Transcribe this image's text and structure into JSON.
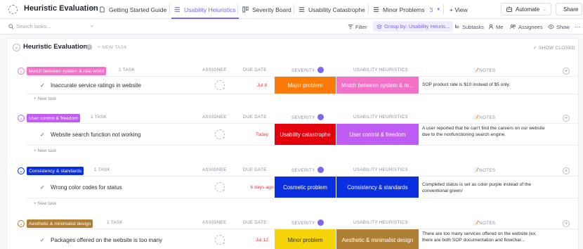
{
  "app": {
    "title": "Heuristic Evaluation",
    "more": "•••",
    "tabs": [
      {
        "label": "Getting Started Guide",
        "icon": "doc-icon"
      },
      {
        "label": "Usability Heiuristics",
        "icon": "list-icon",
        "active": true
      },
      {
        "label": "Severity Board",
        "icon": "board-icon"
      },
      {
        "label": "Usability Catastrophe",
        "icon": "list-icon"
      },
      {
        "label": "Minor Problems",
        "icon": "list-icon",
        "extra": "3"
      }
    ],
    "view_label": "+ View",
    "automate_label": "Automate",
    "share_label": "Share"
  },
  "filterbar": {
    "search_placeholder": "Search tasks...",
    "filter": "Filter",
    "group_by": "Group by: Usability Heuris...",
    "subtasks": "Subtasks",
    "me": "Me",
    "assignees": "Assignees",
    "show": "Show"
  },
  "list": {
    "title": "Heuristic Evaluation",
    "new_task": "+ NEW TASK",
    "show_closed": "SHOW CLOSED",
    "col_assignee": "ASSIGNEE",
    "col_due": "DUE DATE",
    "col_severity": "SEVERITY",
    "col_uh": "USABILITY HEURISTICS",
    "col_notes": "NOTES",
    "add_task": "+ New task",
    "groups": [
      {
        "label": "Match between system & real world",
        "color": "#f371c6",
        "count": "1 TASK",
        "task": "Inaccurate service ratings in website",
        "due": "Jul 8",
        "severity": "Major problem",
        "severity_color": "#fb7a08",
        "uh": "Match between system & re...",
        "uh_color": "#f371c6",
        "notes": "SOP product rate is $10 instead of $5 only."
      },
      {
        "label": "User control & freedom",
        "color": "#c05cf6",
        "count": "1 TASK",
        "task": "Website search function not working",
        "due": "Today",
        "severity": "Usability catastrophe",
        "severity_color": "#e3000c",
        "uh": "User control & freedom",
        "uh_color": "#c05cf6",
        "notes": "A user reported that he can't find the careers on our website due to the nonfunctioning search engine."
      },
      {
        "label": "Consistency & standards",
        "color": "#0a2fe0",
        "count": "1 TASK",
        "task": "Wrong color codes for status",
        "due": "6 days ago",
        "severity": "Cosmetic problem",
        "severity_color": "#0a2fe0",
        "uh": "Consistency & standards",
        "uh_color": "#0a2fe0",
        "notes": "Completed status is set as color purple instead of the conventional green/"
      },
      {
        "label": "Aesthetic & minimalist design",
        "color": "#b07f33",
        "count": "1 TASK",
        "task": "Packages offered on the website is too many",
        "due": "Jul 12",
        "severity": "Minor problem",
        "severity_color": "#f5d509",
        "severity_text_color": "#2a2e34",
        "uh": "Aesthetic & minimalist design",
        "uh_color": "#b07f33",
        "notes": "There are too many services offered on the website (ex. there are both SOP documentation and flowchar..."
      }
    ]
  }
}
